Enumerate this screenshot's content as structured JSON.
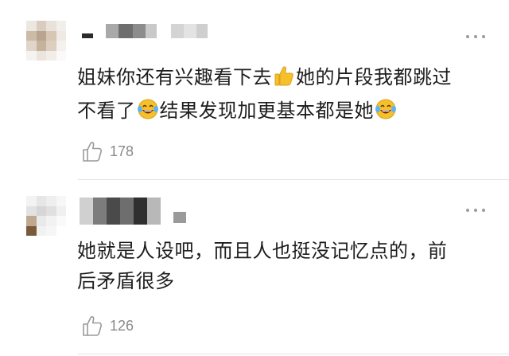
{
  "comments": [
    {
      "line1_a": "姐妹你还有兴趣看下去",
      "line1_b": "她的片段我都跳过",
      "line2_a": "不看了",
      "line2_b": "结果发现加更基本都是她",
      "like_count": "178",
      "emoji_1": "thumbs-up-icon",
      "emoji_2": "laughing-tears-icon"
    },
    {
      "line1": "她就是人设吧，而且人也挺没记忆点的，前",
      "line2": "后矛盾很多",
      "like_count": "126"
    }
  ],
  "colors": {
    "text": "#1e1e1e",
    "meta": "#8a8a8a",
    "divider": "#e4e4e4",
    "emoji_yellow": "#f6c02a"
  }
}
